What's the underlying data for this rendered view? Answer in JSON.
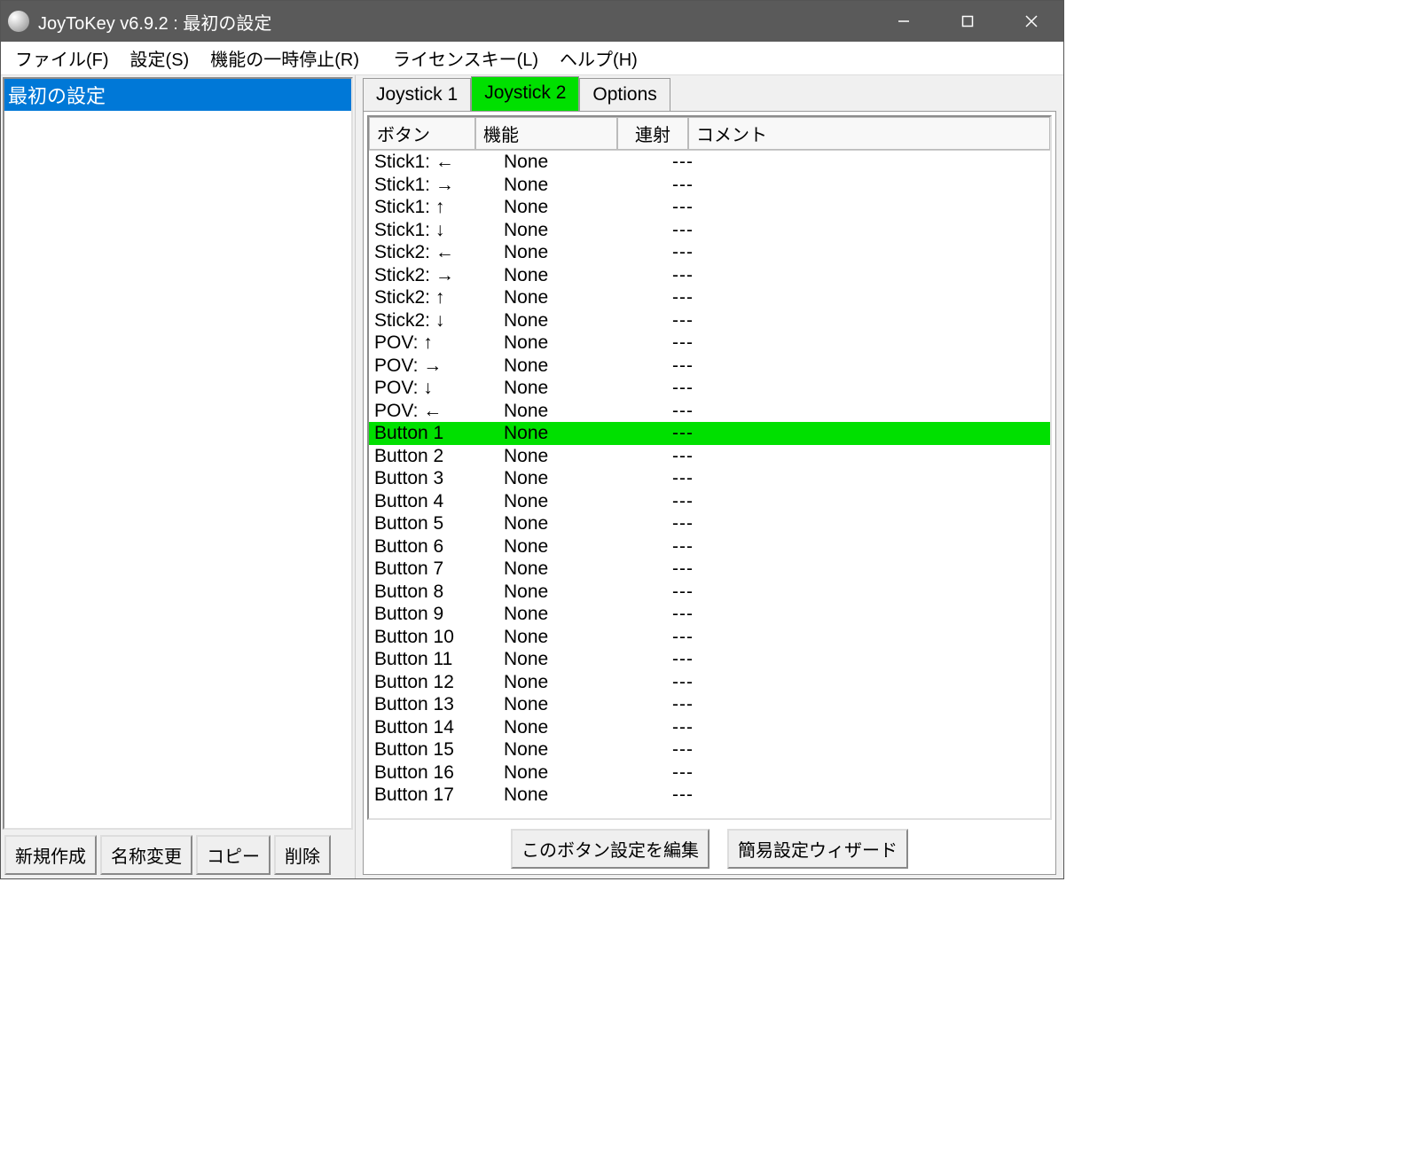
{
  "title": "JoyToKey v6.9.2 : 最初の設定",
  "menu": {
    "file": "ファイル(F)",
    "settings": "設定(S)",
    "pause": "機能の一時停止(R)",
    "license": "ライセンスキー(L)",
    "help": "ヘルプ(H)"
  },
  "profiles": {
    "items": [
      "最初の設定"
    ]
  },
  "left_buttons": {
    "new": "新規作成",
    "rename": "名称変更",
    "copy": "コピー",
    "delete": "削除"
  },
  "tabs": {
    "j1": "Joystick 1",
    "j2": "Joystick 2",
    "options": "Options",
    "active": "j2"
  },
  "table": {
    "headers": {
      "button": "ボタン",
      "function": "機能",
      "rapid": "連射",
      "comment": "コメント"
    },
    "rows": [
      {
        "btn": "Stick1: ←",
        "func": "None",
        "rapid": "---",
        "comment": "",
        "sel": false
      },
      {
        "btn": "Stick1: →",
        "func": "None",
        "rapid": "---",
        "comment": "",
        "sel": false
      },
      {
        "btn": "Stick1: ↑",
        "func": "None",
        "rapid": "---",
        "comment": "",
        "sel": false
      },
      {
        "btn": "Stick1: ↓",
        "func": "None",
        "rapid": "---",
        "comment": "",
        "sel": false
      },
      {
        "btn": "Stick2: ←",
        "func": "None",
        "rapid": "---",
        "comment": "",
        "sel": false
      },
      {
        "btn": "Stick2: →",
        "func": "None",
        "rapid": "---",
        "comment": "",
        "sel": false
      },
      {
        "btn": "Stick2: ↑",
        "func": "None",
        "rapid": "---",
        "comment": "",
        "sel": false
      },
      {
        "btn": "Stick2: ↓",
        "func": "None",
        "rapid": "---",
        "comment": "",
        "sel": false
      },
      {
        "btn": "POV: ↑",
        "func": "None",
        "rapid": "---",
        "comment": "",
        "sel": false
      },
      {
        "btn": "POV: →",
        "func": "None",
        "rapid": "---",
        "comment": "",
        "sel": false
      },
      {
        "btn": "POV: ↓",
        "func": "None",
        "rapid": "---",
        "comment": "",
        "sel": false
      },
      {
        "btn": "POV: ←",
        "func": "None",
        "rapid": "---",
        "comment": "",
        "sel": false
      },
      {
        "btn": "Button 1",
        "func": "None",
        "rapid": "---",
        "comment": "",
        "sel": true
      },
      {
        "btn": "Button 2",
        "func": "None",
        "rapid": "---",
        "comment": "",
        "sel": false
      },
      {
        "btn": "Button 3",
        "func": "None",
        "rapid": "---",
        "comment": "",
        "sel": false
      },
      {
        "btn": "Button 4",
        "func": "None",
        "rapid": "---",
        "comment": "",
        "sel": false
      },
      {
        "btn": "Button 5",
        "func": "None",
        "rapid": "---",
        "comment": "",
        "sel": false
      },
      {
        "btn": "Button 6",
        "func": "None",
        "rapid": "---",
        "comment": "",
        "sel": false
      },
      {
        "btn": "Button 7",
        "func": "None",
        "rapid": "---",
        "comment": "",
        "sel": false
      },
      {
        "btn": "Button 8",
        "func": "None",
        "rapid": "---",
        "comment": "",
        "sel": false
      },
      {
        "btn": "Button 9",
        "func": "None",
        "rapid": "---",
        "comment": "",
        "sel": false
      },
      {
        "btn": "Button 10",
        "func": "None",
        "rapid": "---",
        "comment": "",
        "sel": false
      },
      {
        "btn": "Button 11",
        "func": "None",
        "rapid": "---",
        "comment": "",
        "sel": false
      },
      {
        "btn": "Button 12",
        "func": "None",
        "rapid": "---",
        "comment": "",
        "sel": false
      },
      {
        "btn": "Button 13",
        "func": "None",
        "rapid": "---",
        "comment": "",
        "sel": false
      },
      {
        "btn": "Button 14",
        "func": "None",
        "rapid": "---",
        "comment": "",
        "sel": false
      },
      {
        "btn": "Button 15",
        "func": "None",
        "rapid": "---",
        "comment": "",
        "sel": false
      },
      {
        "btn": "Button 16",
        "func": "None",
        "rapid": "---",
        "comment": "",
        "sel": false
      },
      {
        "btn": "Button 17",
        "func": "None",
        "rapid": "---",
        "comment": "",
        "sel": false
      }
    ]
  },
  "right_buttons": {
    "edit": "このボタン設定を編集",
    "wizard": "簡易設定ウィザード"
  }
}
